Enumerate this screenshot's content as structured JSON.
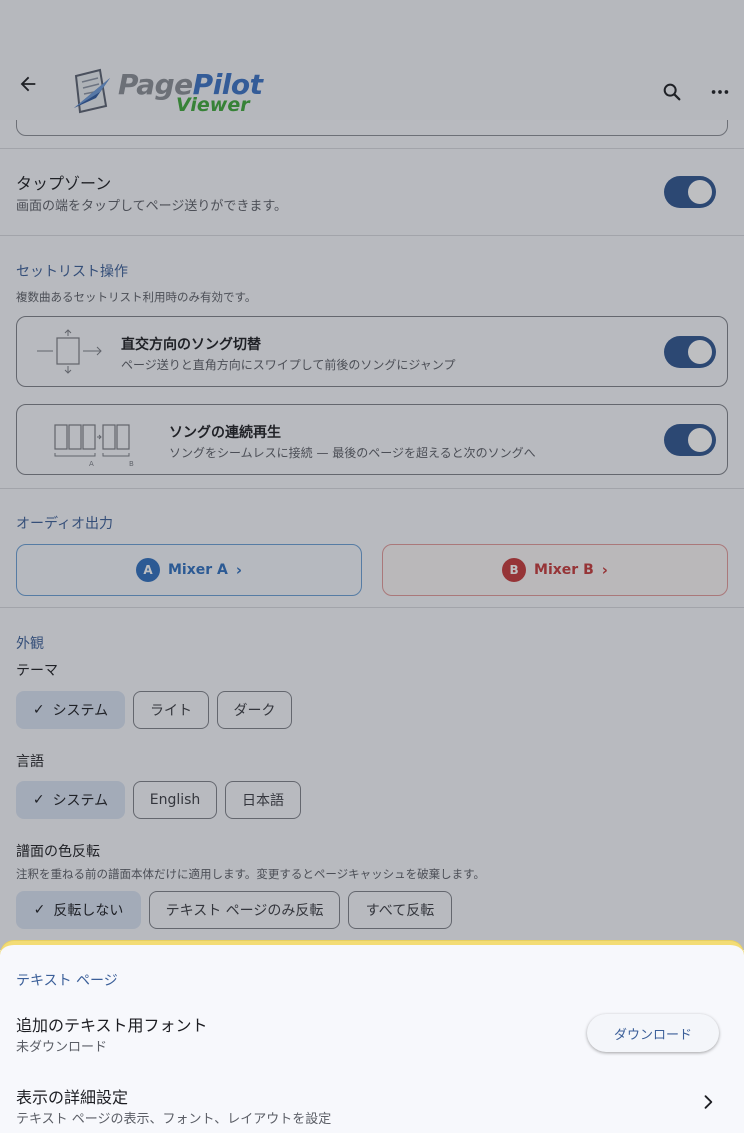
{
  "app": {
    "logo_word1_a": "Page",
    "logo_word1_b": "Pilot",
    "logo_word2": "Viewer"
  },
  "tap_zone": {
    "title": "タップゾーン",
    "subtitle": "画面の端をタップしてページ送りができます。",
    "enabled": true
  },
  "setlist": {
    "heading": "セットリスト操作",
    "note": "複数曲あるセットリスト利用時のみ有効です。",
    "cards": [
      {
        "title": "直交方向のソング切替",
        "subtitle": "ページ送りと直角方向にスワイプして前後のソングにジャンプ",
        "enabled": true
      },
      {
        "title": "ソングの連続再生",
        "subtitle": "ソングをシームレスに接続 — 最後のページを超えると次のソングへ",
        "enabled": true,
        "diagram_labels": [
          "A",
          "B"
        ]
      }
    ]
  },
  "audio": {
    "heading": "オーディオ出力",
    "mixers": [
      {
        "badge": "A",
        "label": "Mixer A",
        "chevron": "›",
        "color": "#2f6fbf"
      },
      {
        "badge": "B",
        "label": "Mixer B",
        "chevron": "›",
        "color": "#c6393a"
      }
    ]
  },
  "appearance": {
    "heading": "外観",
    "theme_label": "テーマ",
    "theme_options": [
      "システム",
      "ライト",
      "ダーク"
    ],
    "language_label": "言語",
    "language_options": [
      "システム",
      "English",
      "日本語"
    ],
    "invert_label": "譜面の色反転",
    "invert_note": "注釈を重ねる前の譜面本体だけに適用します。変更するとページキャッシュを破棄します。",
    "invert_options": [
      "反転しない",
      "テキスト ページのみ反転",
      "すべて反転"
    ],
    "check_glyph": "✓"
  },
  "sheet": {
    "section": "テキスト ページ",
    "font_title": "追加のテキスト用フォント",
    "font_status": "未ダウンロード",
    "download_label": "ダウンロード",
    "detail_title": "表示の詳細設定",
    "detail_sub": "テキスト ページの表示、フォント、レイアウトを設定"
  },
  "colors": {
    "accent": "#2f5590",
    "highlight_border": "#f3dc75"
  }
}
